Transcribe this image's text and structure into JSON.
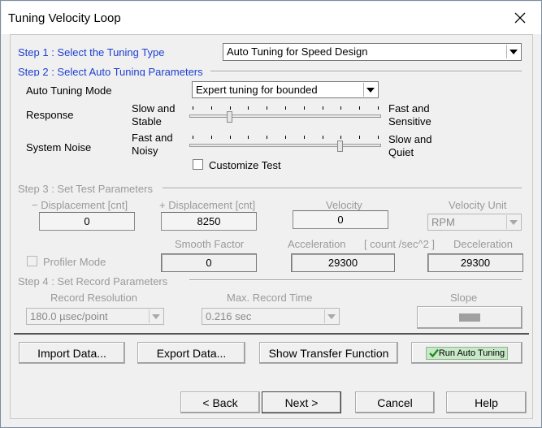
{
  "window": {
    "title": "Tuning Velocity Loop"
  },
  "step1": {
    "label": "Step 1 : Select the  Tuning Type",
    "tuning_type": "Auto Tuning for Speed Design"
  },
  "step2": {
    "label": "Step 2 : Select Auto Tuning Parameters",
    "mode_label": "Auto Tuning Mode",
    "mode_value": "Expert tuning for bounded",
    "response": {
      "label": "Response",
      "left_line1": "Slow and",
      "left_line2": "Stable",
      "right_line1": "Fast and",
      "right_line2": "Sensitive",
      "position": 0.2
    },
    "noise": {
      "label": "System Noise",
      "left_line1": "Fast and",
      "left_line2": "Noisy",
      "right_line1": "Slow and",
      "right_line2": "Quiet",
      "position": 0.8
    },
    "customize_test": "Customize Test"
  },
  "step3": {
    "label": "Step 3 : Set Test  Parameters",
    "neg_disp_label": "− Displacement [cnt]",
    "neg_disp_value": "0",
    "pos_disp_label": "+ Displacement [cnt]",
    "pos_disp_value": "8250",
    "velocity_label": "Velocity",
    "velocity_value": "0",
    "velocity_unit_label": "Velocity Unit",
    "velocity_unit_value": "RPM",
    "profiler_mode": "Profiler Mode",
    "smooth_factor_label": "Smooth Factor",
    "smooth_factor_value": "0",
    "acceleration_label": "Acceleration",
    "accel_unit": "[ count /sec^2 ]",
    "acceleration_value": "29300",
    "deceleration_label": "Deceleration",
    "deceleration_value": "29300"
  },
  "step4": {
    "label": "Step 4 : Set Record Parameters",
    "resolution_label": "Record Resolution",
    "resolution_value": "180.0 µsec/point",
    "max_time_label": "Max. Record Time",
    "max_time_value": "0.216 sec",
    "slope_label": "Slope"
  },
  "actions": {
    "import": "Import Data...",
    "export": "Export Data...",
    "transfer": "Show Transfer Function",
    "run": "Run Auto Tuning"
  },
  "nav": {
    "back": "< Back",
    "next": "Next >",
    "cancel": "Cancel",
    "help": "Help"
  }
}
